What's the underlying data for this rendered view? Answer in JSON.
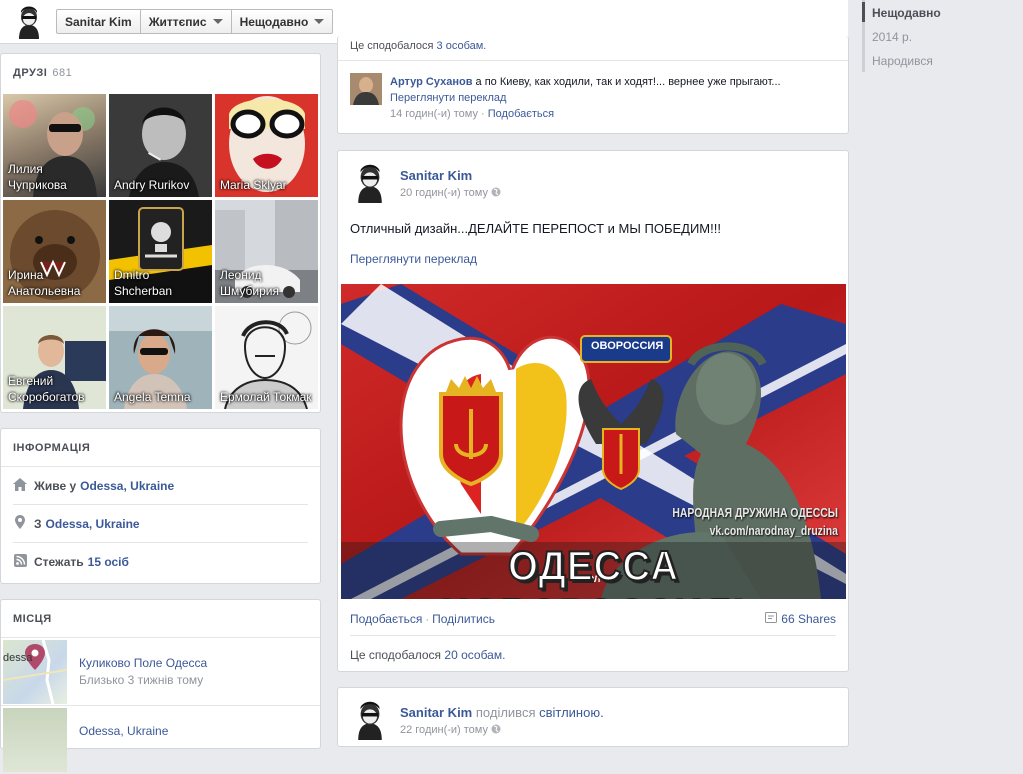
{
  "header": {
    "profile_name": "Sanitar Kim",
    "menu_bio": "Життєпис",
    "menu_recent": "Нещодавно"
  },
  "timeline": {
    "items": [
      "Нещодавно",
      "2014 р.",
      "Народився"
    ]
  },
  "friends": {
    "title": "ДРУЗІ",
    "count": "681",
    "list": [
      {
        "name": "Лилия Чуприкова"
      },
      {
        "name": "Andry Rurikov"
      },
      {
        "name": "Maria Sklyar"
      },
      {
        "name": "Ирина Анатольевна"
      },
      {
        "name": "Dmitro Shcherban"
      },
      {
        "name": "Леонид Шмубирия"
      },
      {
        "name": "Евгений Скоробогатов"
      },
      {
        "name": "Angela Temna"
      },
      {
        "name": "Ермолай Токмак"
      }
    ]
  },
  "info": {
    "title": "ІНФОРМАЦІЯ",
    "lives_label": "Живе у",
    "lives_value": "Odessa, Ukraine",
    "from_label": "З",
    "from_value": "Odessa, Ukraine",
    "follow_label": "Стежать",
    "follow_value": "15 осіб"
  },
  "places": {
    "title": "МІСЦЯ",
    "list": [
      {
        "name": "Куликово Поле Одесса",
        "sub": "Близько 3 тижнів тому",
        "map_label": "dessa"
      },
      {
        "name": "Odessa, Ukraine",
        "sub": ""
      }
    ]
  },
  "post_top": {
    "likes_text": "Це сподобалося",
    "likes_link": "3 особам.",
    "comment": {
      "author": "Артур Суханов",
      "text": "а по Киеву, как ходили, так и ходят!... вернее уже прыгают...",
      "translate": "Переглянути переклад",
      "time": "14 годин(-и) тому",
      "like": "Подобається"
    }
  },
  "post_main": {
    "author": "Sanitar Kim",
    "time": "20 годин(-и) тому",
    "text": "Отличный дизайн...ДЕЛАЙТЕ ПЕРЕПОСТ и МЫ ПОБЕДИМ!!!",
    "translate": "Переглянути переклад",
    "image_caption": "ОДЕССА НОВОРОССИЯ!",
    "image_watermark_1": "НАРОДНАЯ ДРУЖИНА ОДЕССЫ",
    "image_watermark_2": "vk.com/narodnay_druzina",
    "image_banner": "ОВОРОССИЯ",
    "image_lower": "ВОЛ",
    "like": "Подобається",
    "share": "Поділитись",
    "shares": "66 Shares",
    "likes_text": "Це сподобалося",
    "likes_link": "20 особам."
  },
  "post_next": {
    "author": "Sanitar Kim",
    "action": "поділився",
    "action_link": "світлиною.",
    "time": "22 годин(-и) тому"
  },
  "colors": {
    "link": "#3b5998",
    "bg": "#e9eaed",
    "meta": "#90949c"
  }
}
